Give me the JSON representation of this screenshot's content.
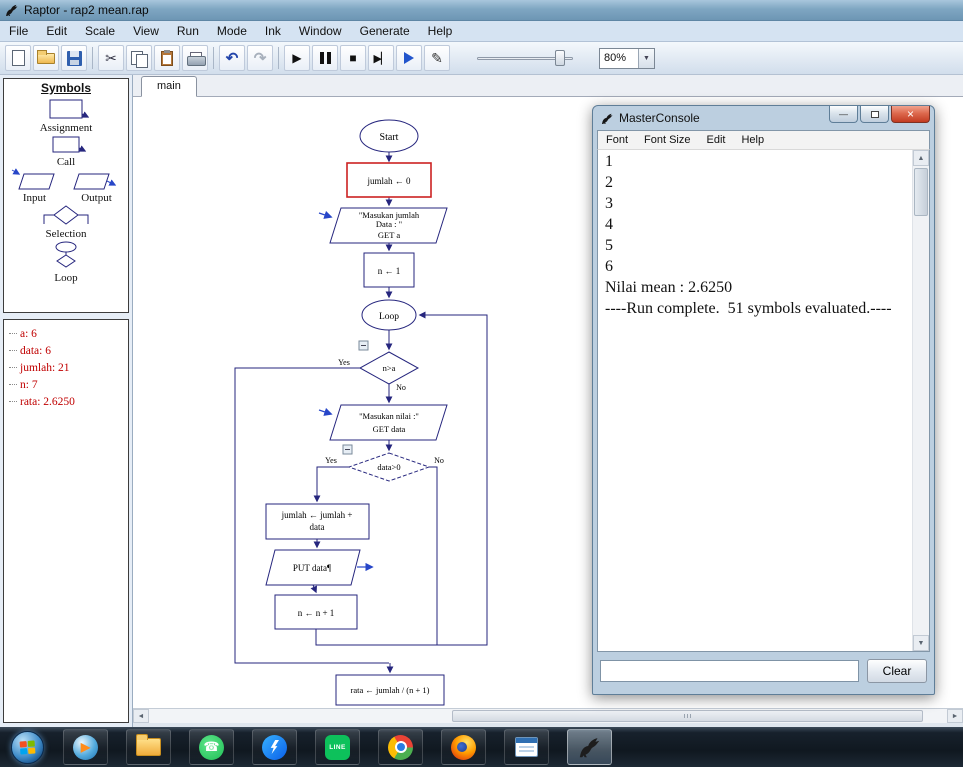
{
  "colors": {
    "accent_navy": "#26267e",
    "executing_red": "#cc2222",
    "watch_red": "#c00000",
    "console_close_red": "#c23c22",
    "titlebar_blue": "#7fa6c2"
  },
  "titlebar": {
    "title": "Raptor - rap2 mean.rap"
  },
  "menubar": {
    "items": [
      "File",
      "Edit",
      "Scale",
      "View",
      "Run",
      "Mode",
      "Ink",
      "Window",
      "Generate",
      "Help"
    ]
  },
  "toolbar": {
    "zoom": "80%"
  },
  "glyphs": {
    "cut": "✂",
    "undo": "↶",
    "redo": "↷",
    "play": "▶",
    "stop": "■",
    "step_end": "▶▏",
    "pen": "✎",
    "dropdown": "▼",
    "scroll_left": "◄",
    "scroll_right": "►",
    "scroll_up": "▲",
    "scroll_down": "▼",
    "minimize": "—",
    "close": "×",
    "wmp_play": "▶",
    "wa_phone": "☎"
  },
  "symbols": {
    "title": "Symbols",
    "labels": [
      "Assignment",
      "Call",
      "Input",
      "Output",
      "Selection",
      "Loop"
    ]
  },
  "watch": {
    "items": [
      "a: 6",
      "data: 6",
      "jumlah: 21",
      "n: 7",
      "rata: 2.6250"
    ]
  },
  "tabs": {
    "main": "main"
  },
  "flowchart": {
    "start": "Start",
    "assign_jumlah": "jumlah ← 0",
    "input_jumlah": [
      "\"Masukan jumlah",
      "Data : \"",
      "GET a"
    ],
    "assign_n": "n ← 1",
    "loop": "Loop",
    "cond_loop": "n>a",
    "yes": "Yes",
    "no": "No",
    "input_nilai": [
      "\"Masukan nilai :\"",
      "GET data"
    ],
    "cond_data": "data>0",
    "assign_sum": [
      "jumlah ← jumlah +",
      "data"
    ],
    "put": "PUT data¶",
    "assign_inc": "n ← n + 1",
    "assign_rata": "rata ← jumlah / (n + 1)"
  },
  "console": {
    "title": "MasterConsole",
    "menu": [
      "Font",
      "Font Size",
      "Edit",
      "Help"
    ],
    "lines": [
      "1",
      "2",
      "3",
      "4",
      "5",
      "6",
      "Nilai mean : 2.6250",
      "----Run complete.  51 symbols evaluated.----"
    ],
    "clear": "Clear"
  },
  "taskbar": {
    "line_label": "LINE"
  }
}
